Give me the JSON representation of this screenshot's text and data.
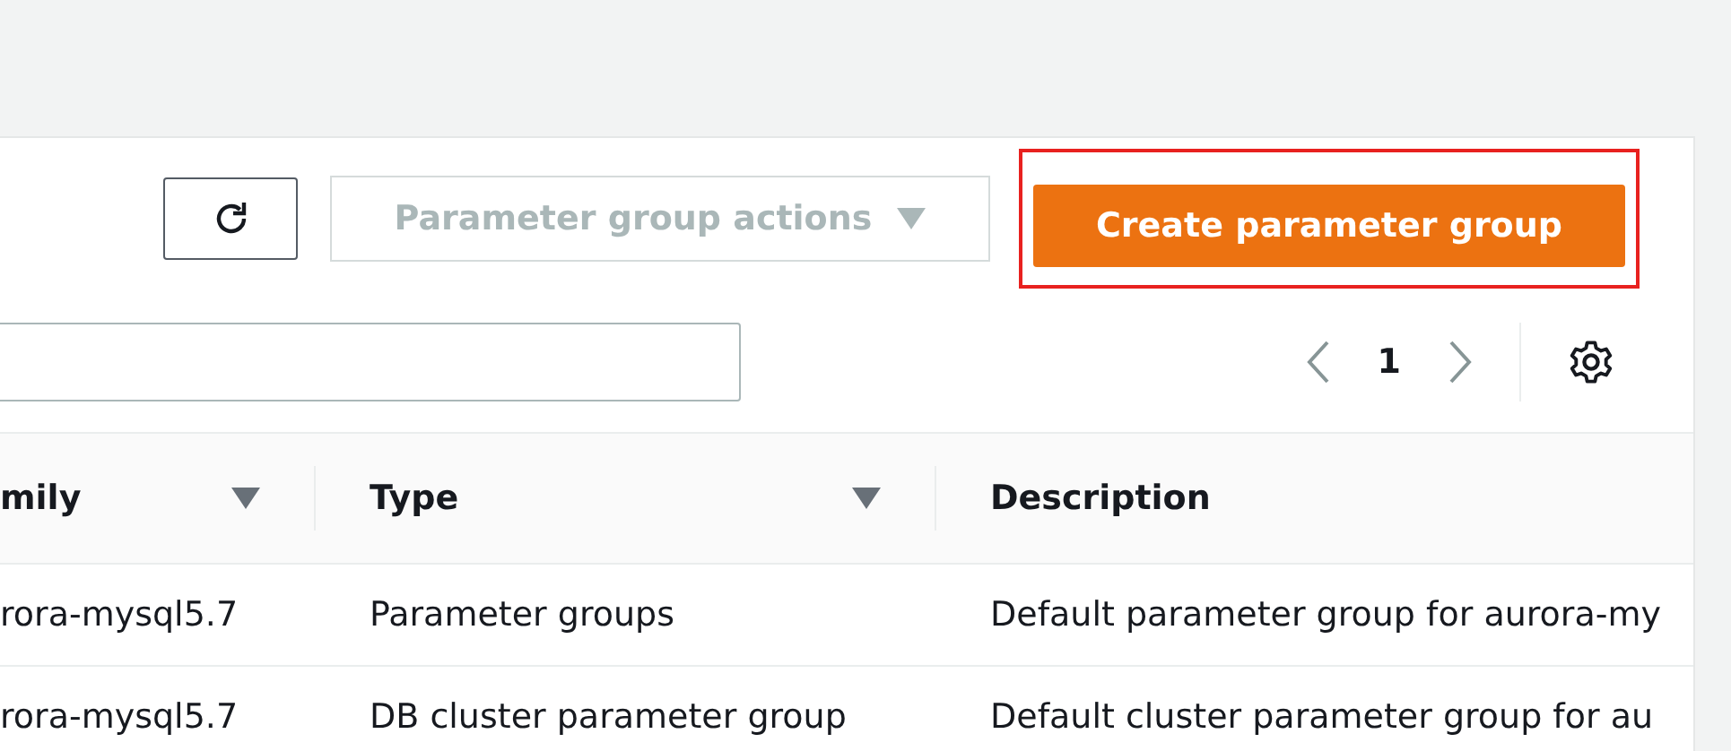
{
  "toolbar": {
    "refresh_button": true,
    "actions_button": {
      "label": "Parameter group actions",
      "disabled": true
    },
    "create_button": {
      "label": "Create parameter group",
      "highlighted": true
    }
  },
  "pagination": {
    "page": "1"
  },
  "table": {
    "columns": [
      {
        "label": "mily",
        "sortable": true
      },
      {
        "label": "Type",
        "sortable": true
      },
      {
        "label": "Description",
        "sortable": false
      }
    ],
    "rows": [
      [
        "rora-mysql5.7",
        "Parameter groups",
        "Default parameter group for aurora-my"
      ],
      [
        "rora-mysql5.7",
        "DB cluster parameter group",
        "Default cluster parameter group for au"
      ]
    ]
  }
}
